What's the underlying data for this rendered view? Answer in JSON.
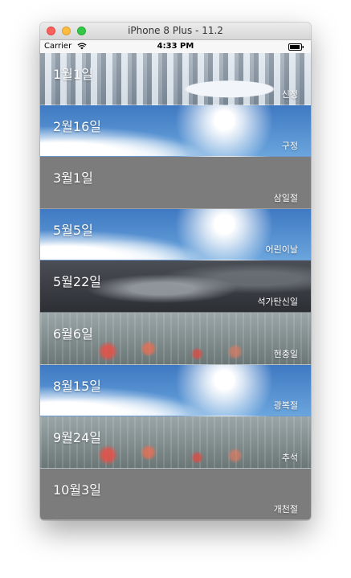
{
  "window": {
    "title": "iPhone 8 Plus - 11.2"
  },
  "status_bar": {
    "carrier": "Carrier",
    "time": "4:33 PM"
  },
  "holidays": [
    {
      "date": "1월1일",
      "name": "신정",
      "background": "snow"
    },
    {
      "date": "2월16일",
      "name": "구정",
      "background": "sky"
    },
    {
      "date": "3월1일",
      "name": "삼일절",
      "background": "gray"
    },
    {
      "date": "5월5일",
      "name": "어린이날",
      "background": "sky"
    },
    {
      "date": "5월22일",
      "name": "석가탄신일",
      "background": "storm"
    },
    {
      "date": "6월6일",
      "name": "현충일",
      "background": "rain"
    },
    {
      "date": "8월15일",
      "name": "광복절",
      "background": "sky"
    },
    {
      "date": "9월24일",
      "name": "추석",
      "background": "rain"
    },
    {
      "date": "10월3일",
      "name": "개천절",
      "background": "gray"
    }
  ]
}
